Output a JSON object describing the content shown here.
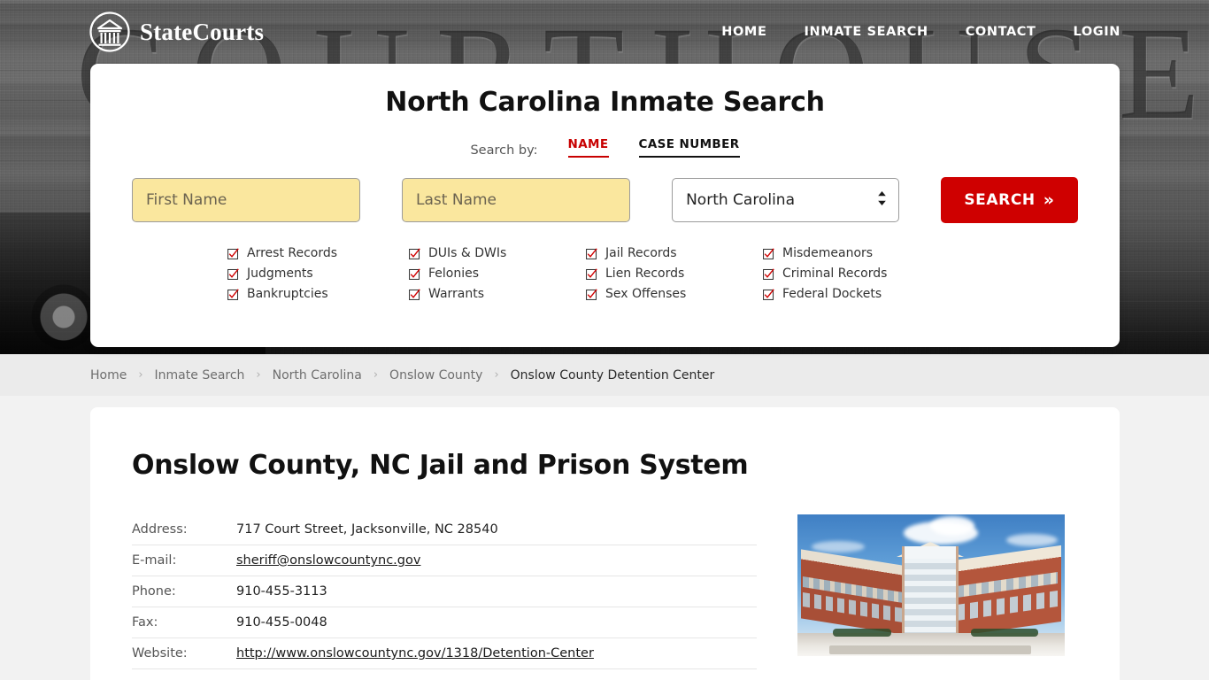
{
  "header": {
    "brand": "StateCourts",
    "logo_icon": "courthouse-circle-icon",
    "nav": [
      {
        "label": "HOME"
      },
      {
        "label": "INMATE SEARCH"
      },
      {
        "label": "CONTACT"
      },
      {
        "label": "LOGIN"
      }
    ],
    "background_word": "COURTHOUSE"
  },
  "search_card": {
    "title": "North Carolina Inmate Search",
    "search_by_label": "Search by:",
    "tabs": [
      {
        "label": "NAME",
        "active": true
      },
      {
        "label": "CASE NUMBER",
        "active": false
      }
    ],
    "first_name_placeholder": "First Name",
    "first_name_value": "",
    "last_name_placeholder": "Last Name",
    "last_name_value": "",
    "state_selected": "North Carolina",
    "state_options": [
      "North Carolina"
    ],
    "search_button": "SEARCH",
    "search_button_chevron": "»",
    "record_types": [
      "Arrest Records",
      "DUIs & DWIs",
      "Jail Records",
      "Misdemeanors",
      "Judgments",
      "Felonies",
      "Lien Records",
      "Criminal Records",
      "Bankruptcies",
      "Warrants",
      "Sex Offenses",
      "Federal Dockets"
    ]
  },
  "breadcrumb": {
    "separator": "›",
    "items": [
      {
        "label": "Home",
        "current": false
      },
      {
        "label": "Inmate Search",
        "current": false
      },
      {
        "label": "North Carolina",
        "current": false
      },
      {
        "label": "Onslow County",
        "current": false
      },
      {
        "label": "Onslow County Detention Center",
        "current": true
      }
    ]
  },
  "content": {
    "page_title": "Onslow County, NC Jail and Prison System",
    "info_rows": [
      {
        "label": "Address:",
        "value": "717 Court Street, Jacksonville, NC 28540",
        "is_link": false
      },
      {
        "label": "E-mail:",
        "value": "sheriff@onslowcountync.gov",
        "is_link": true
      },
      {
        "label": "Phone:",
        "value": "910-455-3113",
        "is_link": false
      },
      {
        "label": "Fax:",
        "value": "910-455-0048",
        "is_link": false
      },
      {
        "label": "Website:",
        "value": "http://www.onslowcountync.gov/1318/Detention-Center",
        "is_link": true
      }
    ],
    "photo_alt": "onslow-county-detention-center-building-photo"
  },
  "colors": {
    "accent_red": "#cf0000",
    "tab_active_red": "#c80000",
    "input_yellow": "#fae79e",
    "breadcrumb_bg": "#ebebeb",
    "page_bg": "#f2f2f2"
  }
}
